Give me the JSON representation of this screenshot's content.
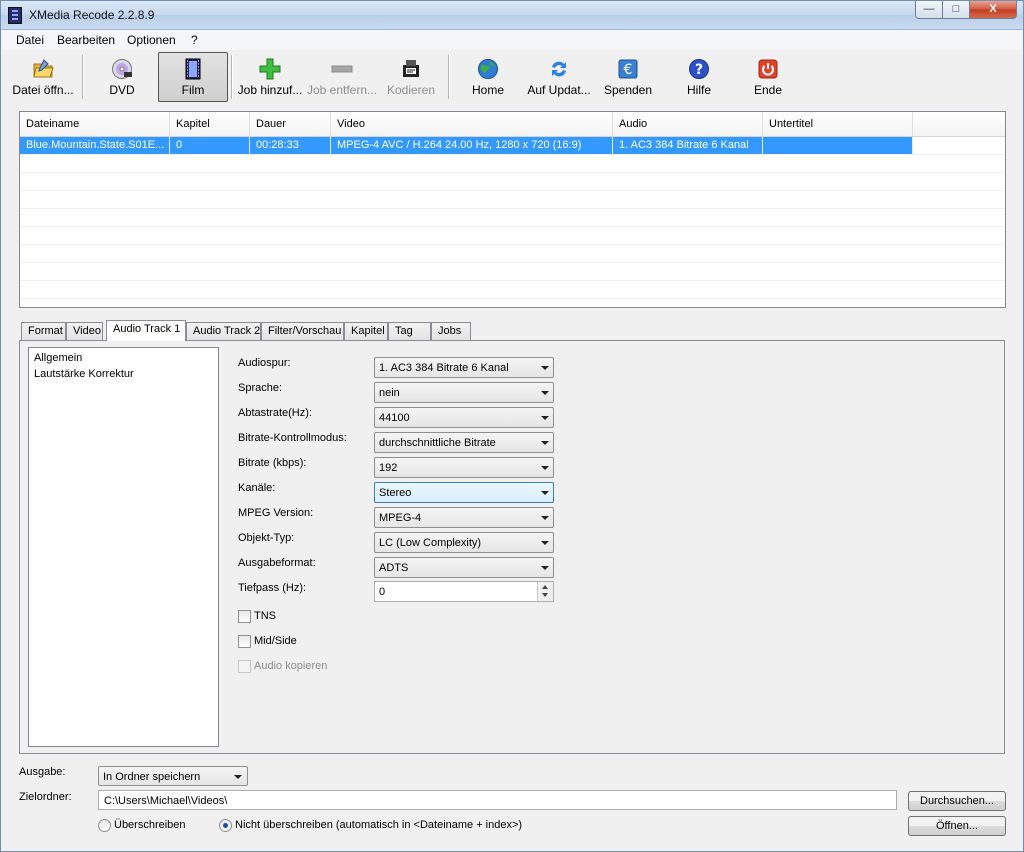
{
  "window": {
    "title": "XMedia Recode 2.2.8.9",
    "close_glyph": "X"
  },
  "menu": [
    "Datei",
    "Bearbeiten",
    "Optionen",
    "?"
  ],
  "toolbar": {
    "open_file": "Datei öffn...",
    "dvd": "DVD",
    "film": "Film",
    "add_job": "Job hinzuf...",
    "remove_job": "Job entfern...",
    "encode": "Kodieren",
    "home": "Home",
    "update": "Auf Updat...",
    "donate": "Spenden",
    "help": "Hilfe",
    "exit": "Ende"
  },
  "filelist": {
    "columns": [
      "Dateiname",
      "Kapitel",
      "Dauer",
      "Video",
      "Audio",
      "Untertitel"
    ],
    "rows": [
      {
        "filename": "Blue.Mountain.State.S01E...",
        "chapter": "0",
        "duration": "00:28:33",
        "video": "MPEG-4 AVC / H.264 24.00 Hz, 1280 x 720 (16:9)",
        "audio": "1. AC3 384 Bitrate 6 Kanal",
        "subtitle": ""
      }
    ]
  },
  "tabs": [
    "Format",
    "Video",
    "Audio Track 1",
    "Audio Track 2",
    "Filter/Vorschau",
    "Kapitel",
    "Tag",
    "Jobs"
  ],
  "active_tab": "Audio Track 1",
  "tree": [
    "Allgemein",
    "Lautstärke Korrektur"
  ],
  "audio": {
    "audiospur": {
      "label": "Audiospur:",
      "value": "1. AC3 384 Bitrate 6 Kanal"
    },
    "sprache": {
      "label": "Sprache:",
      "value": "nein"
    },
    "abtastrate": {
      "label": "Abtastrate(Hz):",
      "value": "44100"
    },
    "bitrate_mode": {
      "label": "Bitrate-Kontrollmodus:",
      "value": "durchschnittliche Bitrate"
    },
    "bitrate": {
      "label": "Bitrate (kbps):",
      "value": "192"
    },
    "kanaele": {
      "label": "Kanäle:",
      "value": "Stereo"
    },
    "mpeg_version": {
      "label": "MPEG Version:",
      "value": "MPEG-4"
    },
    "objekt_typ": {
      "label": "Objekt-Typ:",
      "value": "LC (Low Complexity)"
    },
    "ausgabeformat": {
      "label": "Ausgabeformat:",
      "value": "ADTS"
    },
    "tiefpass": {
      "label": "Tiefpass (Hz):",
      "value": "0"
    },
    "tns": "TNS",
    "mid_side": "Mid/Side",
    "audio_copy": "Audio kopieren"
  },
  "output": {
    "ausgabe_label": "Ausgabe:",
    "ausgabe_value": "In Ordner speichern",
    "zielordner_label": "Zielordner:",
    "zielordner_value": "C:\\Users\\Michael\\Videos\\",
    "browse": "Durchsuchen...",
    "open": "Öffnen...",
    "overwrite": "Überschreiben",
    "no_overwrite": "Nicht überschreiben (automatisch in <Dateiname + index>)"
  },
  "colors": {
    "selection": "#3399ff",
    "accent_green": "#2fa92f",
    "exit_red": "#e2412a"
  }
}
